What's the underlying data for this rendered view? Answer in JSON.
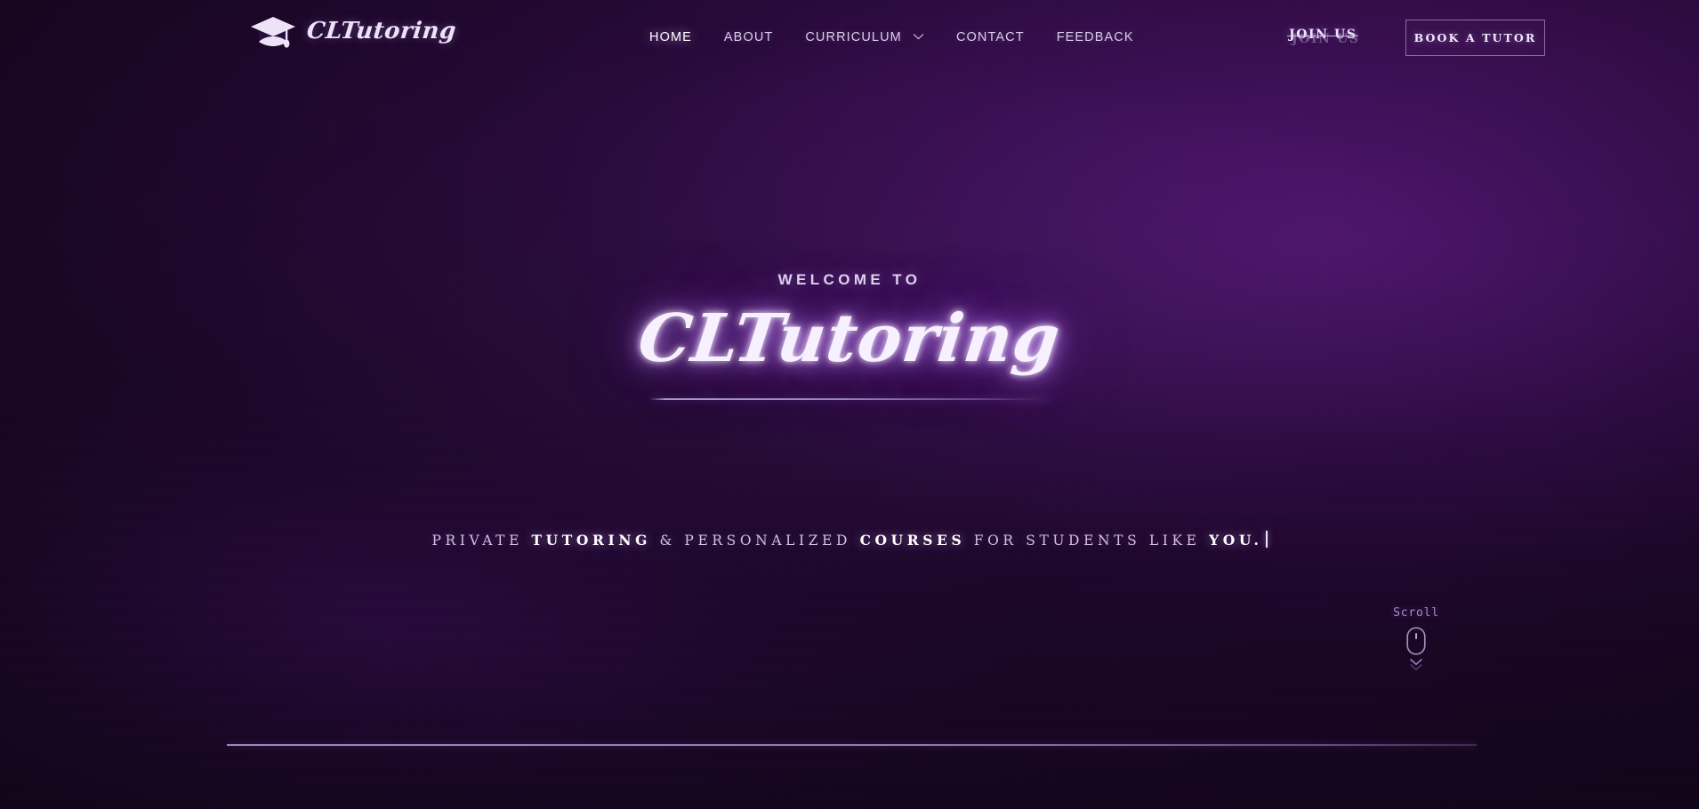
{
  "theme": {
    "bg_dark": "#150620",
    "bg_purple": "#3d0e55",
    "accent_glow": "#a55aeb",
    "text_light": "#f6f0ff",
    "text_muted": "#cfc2e2"
  },
  "header": {
    "brand": {
      "name": "CLTutoring",
      "logo_icon": "graduation-cap-icon"
    },
    "nav": [
      {
        "label": "HOME",
        "active": true,
        "has_dropdown": false
      },
      {
        "label": "ABOUT",
        "active": false,
        "has_dropdown": false
      },
      {
        "label": "CURRICULUM",
        "active": false,
        "has_dropdown": true,
        "dropdown_icon": "chevron-down-icon"
      },
      {
        "label": "CONTACT",
        "active": false,
        "has_dropdown": false
      },
      {
        "label": "FEEDBACK",
        "active": false,
        "has_dropdown": false
      }
    ],
    "join_us_label": "JOIN US",
    "book_tutor_label": "BOOK A TUTOR"
  },
  "hero": {
    "eyebrow": "WELCOME TO",
    "title": "CLTutoring",
    "tagline": {
      "part1": "PRIVATE ",
      "strong1": "TUTORING",
      "part2": " & PERSONALIZED ",
      "strong2": "COURSES",
      "part3": " FOR STUDENTS LIKE ",
      "strong3": "YOU.",
      "full_text": "PRIVATE TUTORING & PERSONALIZED COURSES FOR STUDENTS LIKE YOU."
    }
  },
  "scroll": {
    "label": "Scroll",
    "mouse_icon": "mouse-outline-icon",
    "chevron_icon": "chevron-down-icon"
  }
}
